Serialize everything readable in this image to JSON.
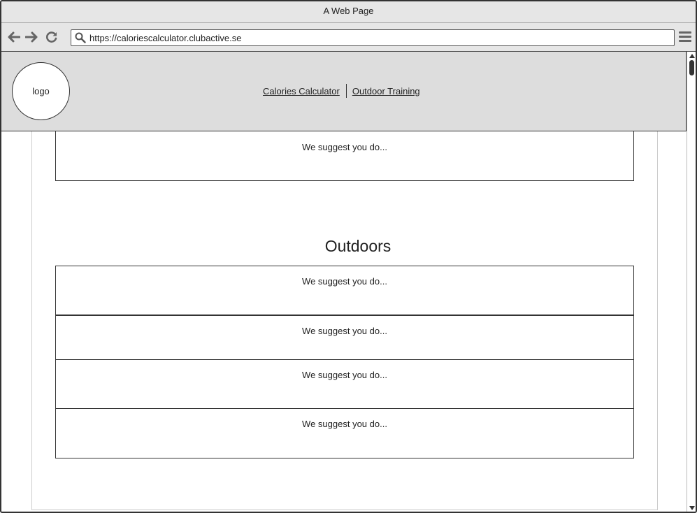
{
  "window": {
    "title": "A Web Page"
  },
  "browser": {
    "url": "https://caloriescalculator.clubactive.se",
    "icons": {
      "back": "arrow-left-icon",
      "forward": "arrow-right-icon",
      "reload": "reload-icon",
      "search": "search-icon",
      "menu": "hamburger-menu-icon"
    }
  },
  "header": {
    "logo_text": "logo",
    "nav": [
      {
        "label": "Calories Calculator"
      },
      {
        "label": "Outdoor Training"
      }
    ]
  },
  "content": {
    "top_box_text": "We suggest you do...",
    "outdoors": {
      "title": "Outdoors",
      "boxes": [
        {
          "text": "We suggest you do..."
        },
        {
          "text": "We suggest you do..."
        },
        {
          "text": "We suggest you do..."
        },
        {
          "text": "We suggest you do..."
        }
      ]
    }
  }
}
